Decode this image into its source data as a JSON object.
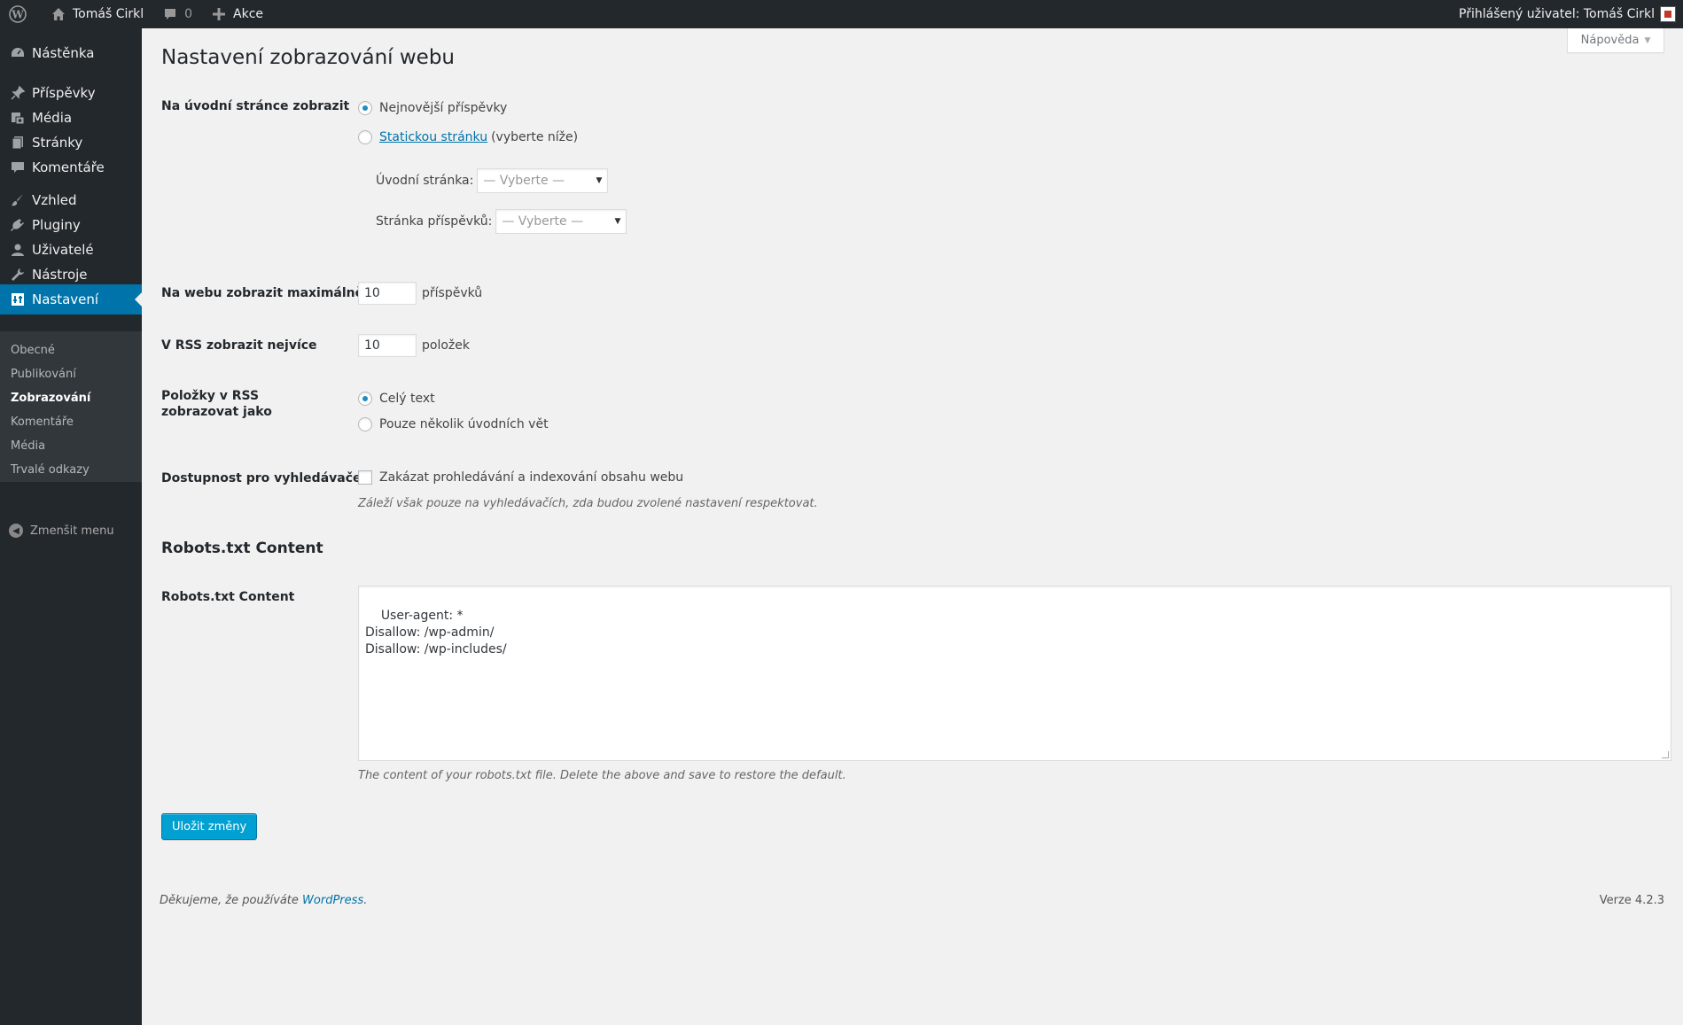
{
  "adminbar": {
    "site_name": "Tomáš Cirkl",
    "comments_count": "0",
    "new_label": "Akce",
    "account_label": "Přihlášený uživatel: Tomáš Cirkl"
  },
  "sidebar": {
    "items": [
      {
        "label": "Nástěnka",
        "icon": "dashboard-icon"
      },
      {
        "label": "Příspěvky",
        "icon": "pin-icon"
      },
      {
        "label": "Média",
        "icon": "media-icon"
      },
      {
        "label": "Stránky",
        "icon": "pages-icon"
      },
      {
        "label": "Komentáře",
        "icon": "comments-icon"
      },
      {
        "label": "Vzhled",
        "icon": "appearance-icon"
      },
      {
        "label": "Pluginy",
        "icon": "plugins-icon"
      },
      {
        "label": "Uživatelé",
        "icon": "users-icon"
      },
      {
        "label": "Nástroje",
        "icon": "tools-icon"
      },
      {
        "label": "Nastavení",
        "icon": "settings-icon"
      }
    ],
    "submenu": [
      "Obecné",
      "Publikování",
      "Zobrazování",
      "Komentáře",
      "Média",
      "Trvalé odkazy"
    ],
    "collapse_label": "Zmenšit menu"
  },
  "help_tab": "Nápověda",
  "page_title": "Nastavení zobrazování webu",
  "front_page": {
    "label": "Na úvodní stránce zobrazit",
    "option_latest": "Nejnovější příspěvky",
    "option_static_link": "Statickou stránku",
    "option_static_suffix": "(vyberte níže)",
    "front_label": "Úvodní stránka:",
    "front_select": "— Vyberte —",
    "posts_label": "Stránka příspěvků:",
    "posts_select": "— Vyberte —"
  },
  "posts_per_page": {
    "label": "Na webu zobrazit maximálně",
    "value": "10",
    "unit": "příspěvků"
  },
  "rss_count": {
    "label": "V RSS zobrazit nejvíce",
    "value": "10",
    "unit": "položek"
  },
  "rss_mode": {
    "label": "Položky v RSS zobrazovat jako",
    "option_full": "Celý text",
    "option_summary": "Pouze několik úvodních vět"
  },
  "search_visibility": {
    "label": "Dostupnost pro vyhledávače",
    "checkbox_label": "Zakázat prohledávání a indexování obsahu webu",
    "description": "Záleží však pouze na vyhledávačích, zda budou zvolené nastavení respektovat."
  },
  "robots": {
    "section_title": "Robots.txt Content",
    "label": "Robots.txt Content",
    "content": "User-agent: *\nDisallow: /wp-admin/\nDisallow: /wp-includes/",
    "description": "The content of your robots.txt file. Delete the above and save to restore the default."
  },
  "save_label": "Uložit změny",
  "footer": {
    "thanks_prefix": "Děkujeme, že používáte ",
    "wordpress_link": "WordPress",
    "thanks_suffix": ".",
    "version": "Verze 4.2.3"
  }
}
